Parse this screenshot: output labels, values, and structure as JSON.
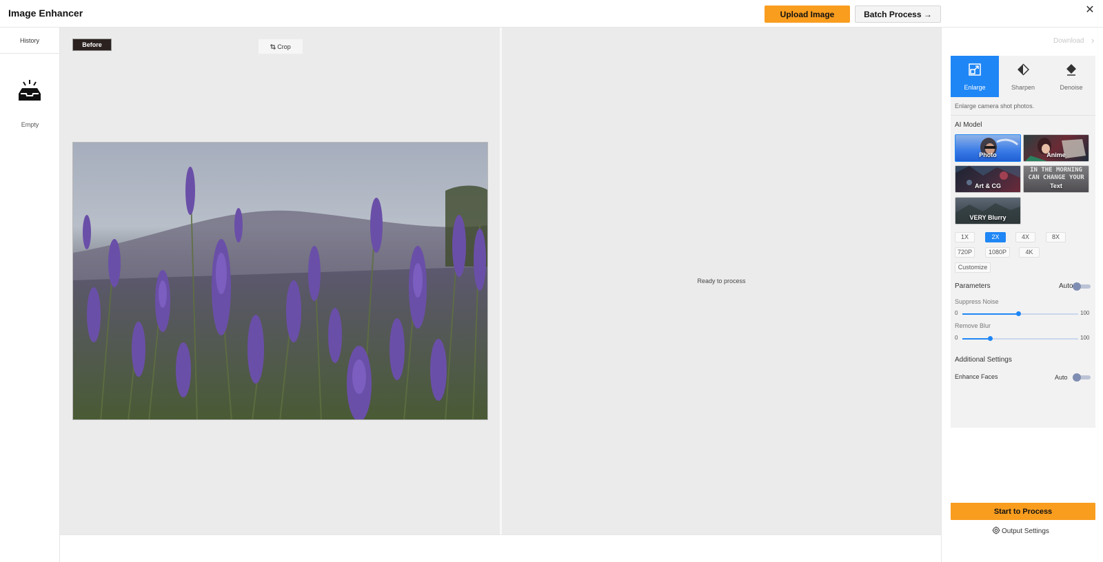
{
  "app": {
    "title": "Image Enhancer"
  },
  "header": {
    "upload_label": "Upload Image",
    "batch_label": "Batch Process →",
    "close_glyph": "✕"
  },
  "history": {
    "tab_label": "History",
    "empty_label": "Empty"
  },
  "canvas": {
    "before_badge": "Before",
    "crop_label": "Crop",
    "ready_text": "Ready to process"
  },
  "panel": {
    "download_label": "Download",
    "download_chevron": "›",
    "modes": [
      {
        "label": "Enlarge",
        "icon": "enlarge-icon",
        "active": true
      },
      {
        "label": "Sharpen",
        "icon": "sharpen-icon",
        "active": false
      },
      {
        "label": "Denoise",
        "icon": "denoise-icon",
        "active": false
      }
    ],
    "mode_description": "Enlarge camera shot photos.",
    "ai_model_title": "AI Model",
    "models": [
      {
        "label": "Photo",
        "selected": true
      },
      {
        "label": "Anime",
        "selected": false
      },
      {
        "label": "Art & CG",
        "selected": false
      },
      {
        "label": "Text",
        "selected": false
      },
      {
        "label": "VERY Blurry",
        "selected": false
      }
    ],
    "text_tile_banner": [
      "IN THE MORNING",
      "CAN CHANGE YOUR"
    ],
    "scales": [
      "1X",
      "2X",
      "4X",
      "8X"
    ],
    "selected_scale": "2X",
    "resolutions": [
      "720P",
      "1080P",
      "4K"
    ],
    "customize_label": "Customize",
    "parameters_title": "Parameters",
    "parameters_auto_label": "Auto",
    "suppress_noise": {
      "label": "Suppress Noise",
      "min": "0",
      "max": "100",
      "value": 48
    },
    "remove_blur": {
      "label": "Remove Blur",
      "min": "0",
      "max": "100",
      "value": 24
    },
    "additional_title": "Additional Settings",
    "enhance_faces_label": "Enhance Faces",
    "enhance_faces_auto_label": "Auto",
    "start_label": "Start to Process",
    "output_settings_label": "Output Settings"
  },
  "colors": {
    "accent_blue": "#1f86f5",
    "accent_orange": "#f99d1f"
  }
}
